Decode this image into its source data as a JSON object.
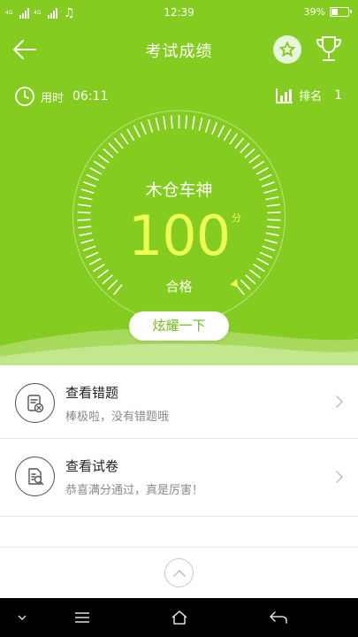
{
  "status_bar": {
    "network_top": "4G",
    "network_bottom": "4G",
    "time": "12:39",
    "battery_percent_label": "39%",
    "battery_level": 0.39
  },
  "header": {
    "title": "考试成绩"
  },
  "stats": {
    "time_label": "用时",
    "time_value": "06:11",
    "rank_label": "排名",
    "rank_value": "1"
  },
  "result": {
    "name": "木仓车神",
    "score": "100",
    "score_unit": "分",
    "status": "合格",
    "score_fraction": 1.0
  },
  "share_button": {
    "label": "炫耀一下"
  },
  "actions": [
    {
      "title": "查看错题",
      "subtitle": "棒极啦，没有错题哦",
      "icon": "wrong-questions-icon"
    },
    {
      "title": "查看试卷",
      "subtitle": "恭喜满分通过，真是厉害！",
      "icon": "exam-paper-icon"
    }
  ],
  "colors": {
    "accent": "#84cc20",
    "score": "#ecff52",
    "button_text": "#6dbd1a"
  }
}
